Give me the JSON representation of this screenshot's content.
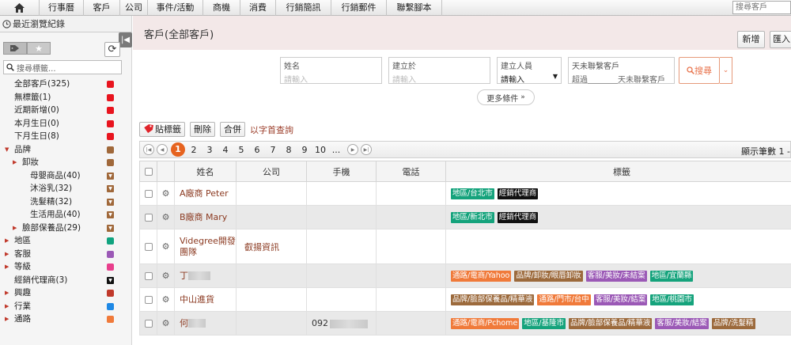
{
  "nav": {
    "items": [
      {
        "label": "行事曆",
        "w": 56
      },
      {
        "label": "客戶",
        "w": 46
      },
      {
        "label": "公司",
        "w": 35
      },
      {
        "label": "事件/活動",
        "w": 70
      },
      {
        "label": "商機",
        "w": 47
      },
      {
        "label": "消費",
        "w": 45
      },
      {
        "label": "行銷簡訊",
        "w": 70
      },
      {
        "label": "行銷郵件",
        "w": 70
      },
      {
        "label": "聯繫腳本",
        "w": 70
      }
    ],
    "search_placeholder": "搜尋客戶"
  },
  "sidebar": {
    "recent": "最近瀏覽紀錄",
    "tag_search_placeholder": "搜尋標籤...",
    "tags": [
      {
        "label": "全部客戶(325)",
        "color": "#e8141e",
        "indent": 0,
        "arrow": ""
      },
      {
        "label": "無標籤(1)",
        "color": "#e8141e",
        "indent": 0,
        "arrow": ""
      },
      {
        "label": "近期新增(0)",
        "color": "#e8141e",
        "indent": 0,
        "arrow": ""
      },
      {
        "label": "本月生日(0)",
        "color": "#e8141e",
        "indent": 0,
        "arrow": ""
      },
      {
        "label": "下月生日(8)",
        "color": "#e8141e",
        "indent": 0,
        "arrow": ""
      },
      {
        "label": "品牌",
        "color": "#a0683a",
        "indent": 0,
        "arrow": "down"
      },
      {
        "label": "卸妝",
        "color": "#a0683a",
        "indent": 1,
        "arrow": "right"
      },
      {
        "label": "母嬰商品(40)",
        "color": "#a0683a",
        "indent": 2,
        "arrow": "",
        "tri": true
      },
      {
        "label": "沐浴乳(32)",
        "color": "#a0683a",
        "indent": 2,
        "arrow": "",
        "tri": true
      },
      {
        "label": "洗髮精(32)",
        "color": "#a0683a",
        "indent": 2,
        "arrow": "",
        "tri": true
      },
      {
        "label": "生活用品(40)",
        "color": "#a0683a",
        "indent": 2,
        "arrow": "",
        "tri": true
      },
      {
        "label": "臉部保養品(29)",
        "color": "#a0683a",
        "indent": 1,
        "arrow": "right",
        "tri": true
      },
      {
        "label": "地區",
        "color": "#10a37f",
        "indent": 0,
        "arrow": "right"
      },
      {
        "label": "客服",
        "color": "#9b59b6",
        "indent": 0,
        "arrow": "right"
      },
      {
        "label": "等級",
        "color": "#e83e8c",
        "indent": 0,
        "arrow": "right"
      },
      {
        "label": "經銷代理商(3)",
        "color": "#111111",
        "indent": 0,
        "arrow": "",
        "tri": true
      },
      {
        "label": "興趣",
        "color": "#c0392b",
        "indent": 0,
        "arrow": "right"
      },
      {
        "label": "行業",
        "color": "#1e88e5",
        "indent": 0,
        "arrow": "right"
      },
      {
        "label": "通路",
        "color": "#f07a3a",
        "indent": 0,
        "arrow": "right"
      }
    ]
  },
  "header": {
    "title": "客戶(全部客戶)",
    "new_label": "新增",
    "import_label": "匯入"
  },
  "filters": {
    "name_label": "姓名",
    "name_ph": "請輸入",
    "created_label": "建立於",
    "created_ph": "請輸入",
    "creator_label": "建立人員",
    "creator_value": "請輸入",
    "nocontact_label": "天未聯繫客戶",
    "nocontact_prefix": "超過",
    "nocontact_suffix": "天未聯繫客戶",
    "search_label": "搜尋",
    "more_label": "更多條件"
  },
  "actions": {
    "tag_label": "貼標籤",
    "delete_label": "刪除",
    "merge_label": "合併",
    "alpha_label": "以字首查詢"
  },
  "pager": {
    "pages": [
      "1",
      "2",
      "3",
      "4",
      "5",
      "6",
      "7",
      "8",
      "9",
      "10",
      "..."
    ],
    "current": "1",
    "info": "顯示筆數 1 -"
  },
  "table": {
    "headers": [
      "姓名",
      "公司",
      "手機",
      "電話",
      "標籤"
    ],
    "rows": [
      {
        "name": "A廠商 Peter",
        "company": "",
        "mobile": "",
        "phone": "",
        "tags": [
          {
            "t": "地區/台北市",
            "c": "#15a37c"
          },
          {
            "t": "經銷代理商",
            "c": "#111111"
          }
        ]
      },
      {
        "name": "B廠商 Mary",
        "company": "",
        "mobile": "",
        "phone": "",
        "tags": [
          {
            "t": "地區/新北市",
            "c": "#15a37c"
          },
          {
            "t": "經銷代理商",
            "c": "#111111"
          }
        ]
      },
      {
        "name": "Videgree開發團隊",
        "company": "叡揚資訊",
        "mobile": "",
        "phone": "",
        "tags": []
      },
      {
        "name": "丁",
        "company": "",
        "mobile": "",
        "phone": "",
        "blur": 28,
        "tags": [
          {
            "t": "通路/電商/Yahoo",
            "c": "#f07a3a"
          },
          {
            "t": "品牌/卸妝/眼唇卸妝",
            "c": "#9c6a3c"
          },
          {
            "t": "客服/美妝/未結案",
            "c": "#9b59b6"
          },
          {
            "t": "地區/宜蘭縣",
            "c": "#15a37c"
          }
        ]
      },
      {
        "name": "中山進貨",
        "company": "",
        "mobile": "",
        "phone": "",
        "tags": [
          {
            "t": "品牌/臉部保養品/精華液",
            "c": "#9c6a3c"
          },
          {
            "t": "通路/門市/台中",
            "c": "#f07a3a"
          },
          {
            "t": "客服/美妝/結案",
            "c": "#9b59b6"
          },
          {
            "t": "地區/桃園市",
            "c": "#15a37c"
          }
        ]
      },
      {
        "name": "何",
        "company": "",
        "mobile": "092",
        "phone": "",
        "blur": 22,
        "tags": [
          {
            "t": "通路/電商/Pchome",
            "c": "#f07a3a"
          },
          {
            "t": "地區/基隆市",
            "c": "#15a37c"
          },
          {
            "t": "品牌/臉部保養品/精華液",
            "c": "#9c6a3c"
          },
          {
            "t": "客服/美妝/結案",
            "c": "#9b59b6"
          },
          {
            "t": "品牌/洗髮精",
            "c": "#9c6a3c"
          }
        ]
      }
    ]
  }
}
